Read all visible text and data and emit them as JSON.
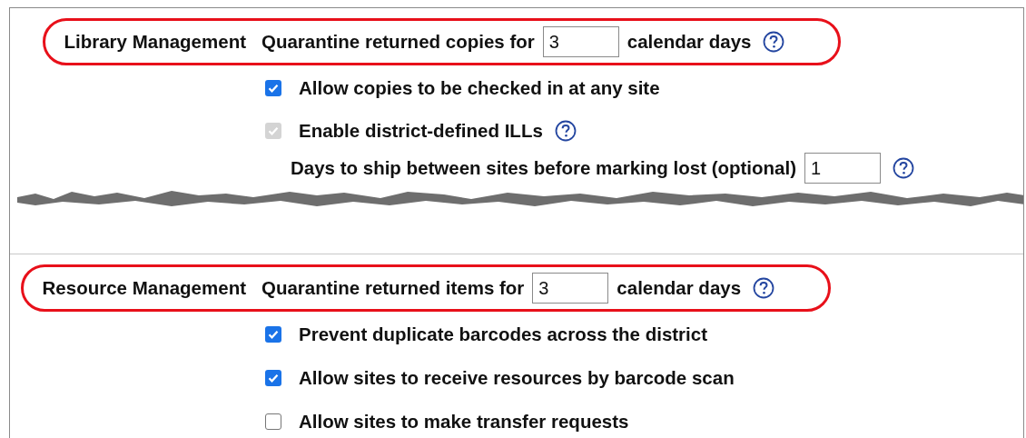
{
  "sections": [
    {
      "title": "Library Management",
      "quarantine": {
        "label": "Quarantine returned copies for",
        "value": "3",
        "unit": "calendar days",
        "help": true
      },
      "options": [
        {
          "kind": "checkbox",
          "label": "Allow copies to be checked in at any site",
          "checked": true,
          "disabled": false,
          "help": false
        },
        {
          "kind": "checkbox",
          "label": "Enable district-defined ILLs",
          "checked": true,
          "disabled": true,
          "help": true
        },
        {
          "kind": "days",
          "label": "Days to ship between sites before marking lost (optional)",
          "value": "1",
          "help": true
        }
      ],
      "torn": true
    },
    {
      "title": "Resource Management",
      "quarantine": {
        "label": "Quarantine returned items for",
        "value": "3",
        "unit": "calendar days",
        "help": true
      },
      "options": [
        {
          "kind": "checkbox",
          "label": "Prevent duplicate barcodes across the district",
          "checked": true,
          "disabled": false,
          "help": false
        },
        {
          "kind": "checkbox",
          "label": "Allow sites to receive resources by barcode scan",
          "checked": true,
          "disabled": false,
          "help": false
        },
        {
          "kind": "checkbox",
          "label": "Allow sites to make transfer requests",
          "checked": false,
          "disabled": false,
          "help": false
        }
      ],
      "torn": false
    }
  ]
}
